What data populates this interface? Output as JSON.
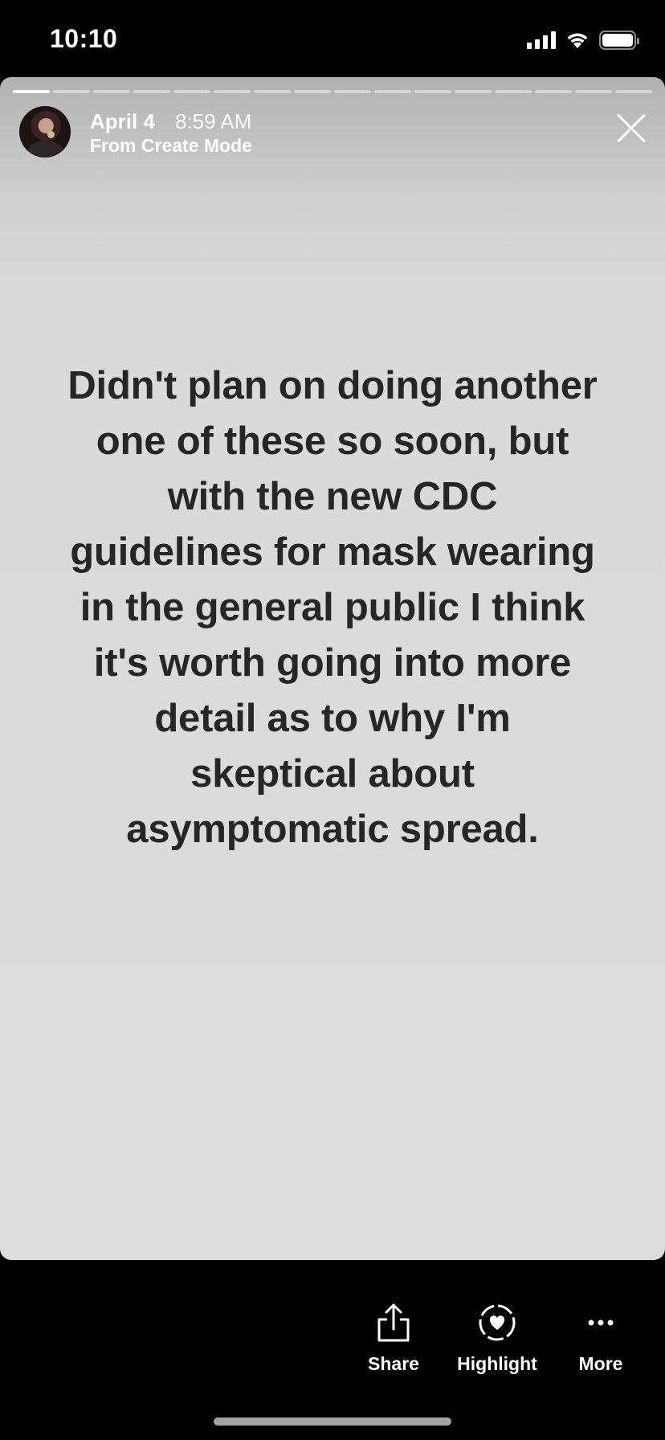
{
  "status_bar": {
    "time": "10:10",
    "icons": [
      "cellular-signal-icon",
      "wifi-icon",
      "battery-icon"
    ]
  },
  "story": {
    "segment_count": 16,
    "active_segment": 1,
    "date": "April 4",
    "time": "8:59 AM",
    "source": "From Create Mode",
    "text": "Didn't plan on doing another one of these so soon, but with the new CDC guidelines for mask wearing in the general public I think it's worth going into more detail as to why I'm skeptical about asymptomatic spread.",
    "background_color": "#dcdcdc",
    "text_color": "#262626"
  },
  "actions": {
    "share": {
      "label": "Share",
      "icon": "share-icon"
    },
    "highlight": {
      "label": "Highlight",
      "icon": "highlight-heart-icon"
    },
    "more": {
      "label": "More",
      "icon": "more-dots-icon"
    }
  }
}
